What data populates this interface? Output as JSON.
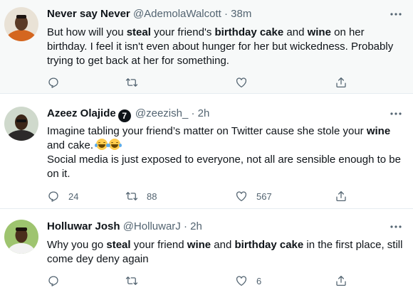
{
  "tweets": [
    {
      "name": "Never say Never",
      "handle": "@AdemolaWalcott",
      "separator": "·",
      "time": "38m",
      "lines": [
        [
          {
            "t": "But how will you ",
            "b": false
          },
          {
            "t": "steal",
            "b": true
          },
          {
            "t": " your friend's ",
            "b": false
          },
          {
            "t": "birthday cake",
            "b": true
          },
          {
            "t": " and ",
            "b": false
          },
          {
            "t": "wine",
            "b": true
          },
          {
            "t": " on her",
            "b": false
          }
        ],
        [
          {
            "t": "birthday. I feel it isn't even about hunger for her but wickedness. Probably",
            "b": false
          }
        ],
        [
          {
            "t": "trying to get back at her for something.",
            "b": false
          }
        ]
      ],
      "counts": {
        "reply": "",
        "retweet": "",
        "like": ""
      },
      "avatar_color": "#d4661f"
    },
    {
      "name": "Azeez Olajide",
      "badge": "7",
      "handle": "@zeezish_",
      "separator": "·",
      "time": "2h",
      "lines": [
        [
          {
            "t": "Imagine tabling your friend’s matter on Twitter cause she stole your ",
            "b": false
          },
          {
            "t": "wine",
            "b": true
          }
        ],
        [
          {
            "t": "and cake. ",
            "b": false
          },
          {
            "emoji": "joy"
          },
          {
            "emoji": "joy"
          }
        ],
        [
          {
            "t": "Social media is just exposed to everyone, not all are sensible enough to be",
            "b": false
          }
        ],
        [
          {
            "t": "on it.",
            "b": false
          }
        ]
      ],
      "counts": {
        "reply": "24",
        "retweet": "88",
        "like": "567"
      },
      "avatar_color": "#c9d7c8"
    },
    {
      "name": "Holluwar Josh",
      "handle": "@HolluwarJ",
      "separator": "·",
      "time": "2h",
      "lines": [
        [
          {
            "t": "Why you go ",
            "b": false
          },
          {
            "t": "steal",
            "b": true
          },
          {
            "t": " your friend ",
            "b": false
          },
          {
            "t": "wine",
            "b": true
          },
          {
            "t": " and ",
            "b": false
          },
          {
            "t": "birthday cake",
            "b": true
          },
          {
            "t": " in the first place, still",
            "b": false
          }
        ],
        [
          {
            "t": "come dey deny again",
            "b": false
          }
        ]
      ],
      "counts": {
        "reply": "",
        "retweet": "",
        "like": "6"
      },
      "avatar_color": "#7fae58"
    }
  ],
  "icons": {
    "reply": "reply-icon",
    "retweet": "retweet-icon",
    "like": "like-icon",
    "share": "share-icon",
    "more": "more-icon"
  },
  "colors": {
    "text": "#0f1419",
    "secondary": "#536471",
    "highlight_bg": "#f7f9f9",
    "border": "#e6ecf0"
  }
}
